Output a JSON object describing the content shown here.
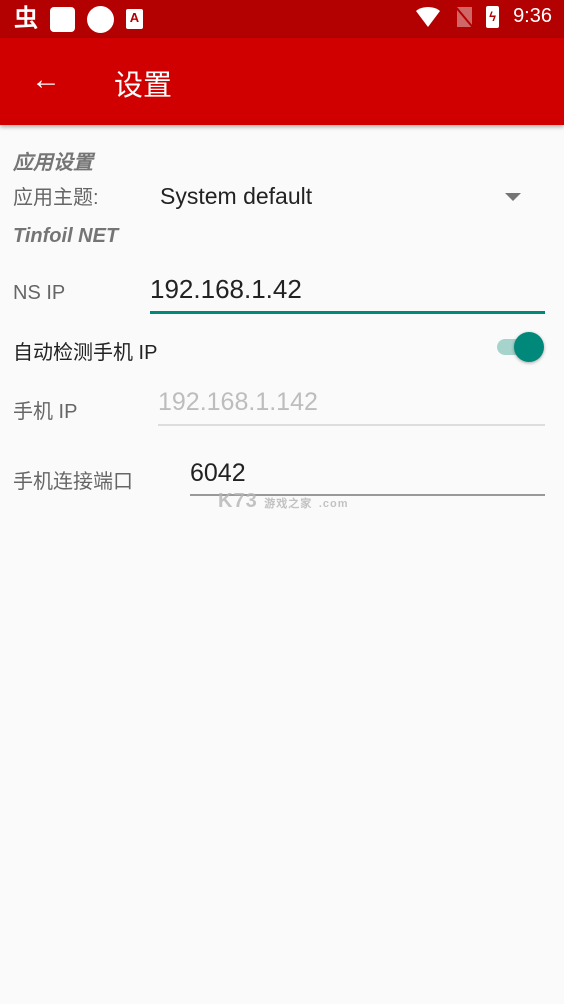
{
  "status_bar": {
    "left_icons": [
      "bug-notification-icon",
      "square-notification-icon",
      "circle-notification-icon",
      "a-notification-icon"
    ],
    "a_icon_glyph": "A",
    "bug_icon_glyph": "虫",
    "battery_glyph": "ϟ",
    "right_icons": [
      "wifi-icon",
      "no-sim-icon",
      "battery-charging-icon"
    ],
    "time": "9:36"
  },
  "app_bar": {
    "back_glyph": "←",
    "title": "设置",
    "color": "#d00000"
  },
  "sections": {
    "app_settings_title": "应用设置",
    "tinfoil_title": "Tinfoil NET"
  },
  "theme": {
    "label": "应用主题:",
    "selected": "System default"
  },
  "ns_ip": {
    "label": "NS IP",
    "value": "192.168.1.42"
  },
  "auto_detect": {
    "label": "自动检测手机 IP",
    "enabled": true,
    "accent": "#00897b"
  },
  "phone_ip": {
    "label": "手机 IP",
    "value": "192.168.1.142",
    "disabled": true
  },
  "phone_port": {
    "label": "手机连接端口",
    "value": "6042"
  },
  "watermark": {
    "brand": "K73",
    "tagline": "游戏之家",
    "domain": ".com"
  }
}
